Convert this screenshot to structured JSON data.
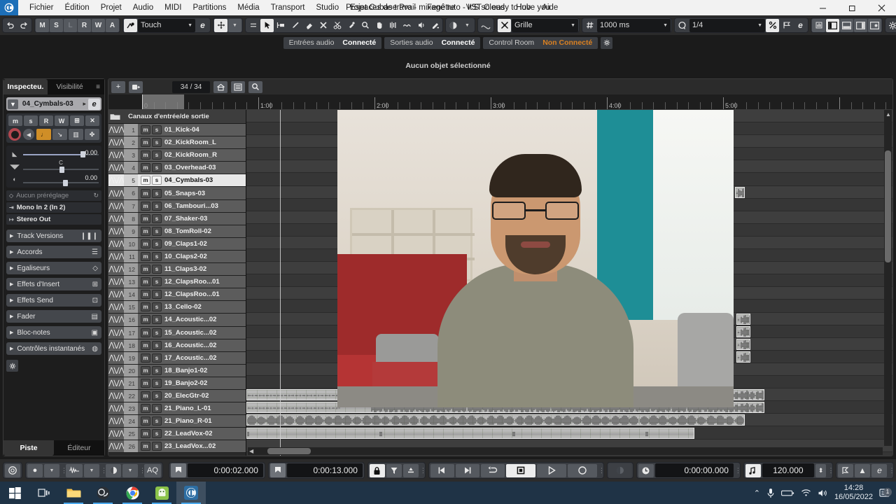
{
  "window": {
    "title": "Projet Cubase Pro - mixage tuto - It'S so easy to love you",
    "logo": "cubase-logo",
    "minimize": "—",
    "maximize": "❐",
    "close": "✕"
  },
  "menu": [
    "Fichier",
    "Édition",
    "Projet",
    "Audio",
    "MIDI",
    "Partitions",
    "Média",
    "Transport",
    "Studio",
    "Espaces de travail",
    "Fenêtre",
    "VST Cloud",
    "Hub",
    "Aide"
  ],
  "toolbar": {
    "undo": "↺",
    "redo": "↻",
    "states": [
      "M",
      "S",
      "L",
      "R",
      "W",
      "A"
    ],
    "automation_mode": "Touch",
    "automation_icon": "automation-icon",
    "edit_mode_e": "e",
    "tools": [
      "arrow-tool",
      "range-tool",
      "glue-tool",
      "draw-tool",
      "erase-tool",
      "split-tool",
      "mute-tool",
      "zoom-tool",
      "hand-tool",
      "warp-tool",
      "line-tool",
      "play-tool",
      "color-tool"
    ],
    "color_label": "color-dropdown",
    "snap_toggle": "snap-icon",
    "grid_label": "Grille",
    "grid_value": "1000 ms",
    "quantize_label": "Q",
    "quantize_value": "1/4",
    "right_tools": [
      "ratio-icon",
      "flag-icon",
      "e-icon",
      "meter-icon",
      "left-zone-icon",
      "lower-zone-icon",
      "right-zone-icon",
      "window-layout-icon",
      "setup-gear-icon"
    ]
  },
  "connections": [
    {
      "label": "Entrées audio",
      "status": "Connecté",
      "ok": true
    },
    {
      "label": "Sorties audio",
      "status": "Connecté",
      "ok": true
    },
    {
      "label": "Control Room",
      "status": "Non Connecté",
      "ok": false
    }
  ],
  "info_line": "Aucun objet sélectionné",
  "inspector": {
    "tabs": [
      {
        "label": "Inspecteu.",
        "active": true
      },
      {
        "label": "Visibilité",
        "active": false
      }
    ],
    "track_name": "04_Cymbals-03",
    "edit_btn": "e",
    "buttons_row1": [
      "m",
      "s",
      "R",
      "W",
      "⊞",
      "✕"
    ],
    "record_btn": "record-enable",
    "monitor_btn": "monitor",
    "type_buttons": [
      "♩",
      "↘",
      "▥",
      "✤"
    ],
    "volume_value": "0.00",
    "pan_value": "C",
    "delay_value": "0.00",
    "preset": "Aucun préréglage",
    "input_routing": "Mono In 2 (In 2)",
    "output_routing": "Stereo Out",
    "sections": [
      {
        "label": "Track Versions",
        "icon": "versions-icon"
      },
      {
        "label": "Accords",
        "icon": "chords-icon"
      },
      {
        "label": "Égaliseurs",
        "icon": "eq-icon"
      },
      {
        "label": "Effets d'Insert",
        "icon": "insert-icon"
      },
      {
        "label": "Effets Send",
        "icon": "send-icon"
      },
      {
        "label": "Fader",
        "icon": "fader-icon"
      },
      {
        "label": "Bloc-notes",
        "icon": "notes-icon"
      },
      {
        "label": "Contrôles instantanés",
        "icon": "quick-controls-icon"
      }
    ],
    "gear": "⚙",
    "foot_tabs": [
      {
        "label": "Piste",
        "active": true
      },
      {
        "label": "Éditeur",
        "active": false
      }
    ]
  },
  "arrange": {
    "add_track": "+",
    "add_track_menu": "track-preset-icon",
    "track_count": "34 / 34",
    "view_btn1": "home-icon",
    "view_btn2": "list-icon",
    "search": "search-icon",
    "folder_icon": "folder-icon",
    "io_header": "Canaux d'entrée/de sortie",
    "ruler_labels": [
      "0",
      "1:00",
      "2:00",
      "3:00",
      "4:00",
      "5:00"
    ],
    "tracks": [
      {
        "n": "1",
        "name": "01_Kick-04"
      },
      {
        "n": "2",
        "name": "02_KickRoom_L"
      },
      {
        "n": "3",
        "name": "02_KickRoom_R"
      },
      {
        "n": "4",
        "name": "03_Overhead-03"
      },
      {
        "n": "5",
        "name": "04_Cymbals-03",
        "selected": true
      },
      {
        "n": "6",
        "name": "05_Snaps-03"
      },
      {
        "n": "7",
        "name": "06_Tambouri...03"
      },
      {
        "n": "8",
        "name": "07_Shaker-03"
      },
      {
        "n": "9",
        "name": "08_TomRoll-02"
      },
      {
        "n": "10",
        "name": "09_Claps1-02"
      },
      {
        "n": "11",
        "name": "10_Claps2-02"
      },
      {
        "n": "12",
        "name": "11_Claps3-02"
      },
      {
        "n": "13",
        "name": "12_ClapsRoo...01"
      },
      {
        "n": "14",
        "name": "12_ClapsRoo...01"
      },
      {
        "n": "15",
        "name": "13_Cello-02"
      },
      {
        "n": "16",
        "name": "14_Acoustic...02"
      },
      {
        "n": "17",
        "name": "15_Acoustic...02"
      },
      {
        "n": "18",
        "name": "16_Acoustic...02"
      },
      {
        "n": "19",
        "name": "17_Acoustic...02"
      },
      {
        "n": "20",
        "name": "18_Banjo1-02"
      },
      {
        "n": "21",
        "name": "19_Banjo2-02"
      },
      {
        "n": "22",
        "name": "20_ElecGtr-02"
      },
      {
        "n": "23",
        "name": "21_Piano_L-01"
      },
      {
        "n": "24",
        "name": "21_Piano_R-01"
      },
      {
        "n": "25",
        "name": "22_LeadVox-02"
      },
      {
        "n": "26",
        "name": "23_LeadVox...02"
      }
    ],
    "mute_label": "m",
    "solo_label": "s"
  },
  "transport": {
    "cycle_icon": "cycle-icon",
    "record_mode_icon": "record-mode-icon",
    "punch_icon": "punch-icon",
    "metronome_icon": "metronome-icon",
    "auto_quantize": "AQ",
    "left_locator_icon": "left-locator-icon",
    "left_locator": "0:00:02.000",
    "right_locator_icon": "right-locator-icon",
    "right_locator": "0:00:13.000",
    "lock_icon": "lock-icon",
    "filter_icon": "filter-icon",
    "punch_in_icon": "punch-in-icon",
    "rewind": "◁◁",
    "forward": "▷▷",
    "cycle": "↻",
    "stop": "■",
    "play": "▶",
    "record": "●",
    "jog_icon": "jog-icon",
    "clock_icon": "clock-icon",
    "primary_time": "0:00:00.000",
    "tempo_icon": "tempo-icon",
    "tempo": "120.000",
    "tempo_spin": "⬍",
    "marker_icons": [
      "marker-icon",
      "pitch-icon",
      "e-icon"
    ],
    "meter_label": "audio-level-meter",
    "settings_gear": "⚙"
  },
  "taskbar": {
    "items": [
      "windows-start-icon",
      "task-view-icon",
      "file-explorer-icon",
      "obs-icon",
      "chrome-icon",
      "android-studio-icon",
      "cubase-icon"
    ],
    "tray": [
      "chevron-up-icon",
      "microphone-icon",
      "battery-icon",
      "wifi-icon",
      "volume-icon"
    ],
    "time": "14:28",
    "date": "16/05/2022",
    "notifications_icon": "notifications-icon",
    "notifications_count": "1"
  }
}
